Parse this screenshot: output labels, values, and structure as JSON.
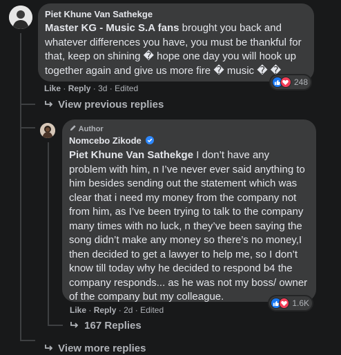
{
  "comment1": {
    "author": "Piet Khune Van Sathekge",
    "tag": "Master KG - Music S.A fans",
    "text": " brought you back and whatever differences you have, you must be thankful for that, keep on shining � hope one day you will hook up together again and give us more fire � music � �",
    "like_label": "Like",
    "reply_label": "Reply",
    "time": "3d",
    "edited_label": "Edited",
    "reaction_count": "248"
  },
  "view_previous_label": "View previous replies",
  "reply1": {
    "badge": "Author",
    "author": "Nomcebo Zikode",
    "tag": "Piet Khune Van Sathekge",
    "text": " I don’t have any problem with him, n I’ve never ever said anything to him besides sending out the statement which was clear that i need my money from the company not from him, as I’ve been trying to talk to the company many times with no luck, n they’ve been saying the song didn’t make any money so there’s no money,I then decided to get a lawyer to help me, so I don’t know till today why he decided to respond b4 the company responds... as he was not my boss/ owner of the company but my colleague.",
    "like_label": "Like",
    "reply_label": "Reply",
    "time": "2d",
    "edited_label": "Edited",
    "reaction_count": "1.6K",
    "replies_label": "167 Replies"
  },
  "view_more_label": "View more replies",
  "colors": {
    "background": "#18191a",
    "bubble": "#3a3b3c",
    "text": "#e4e6eb",
    "secondary": "#b0b3b8",
    "like_blue": "#1877f2",
    "love_red": "#f33e58"
  },
  "icons": [
    "avatar-photo",
    "reply-arrow-icon",
    "pencil-icon",
    "verified-badge-icon",
    "like-reaction-icon",
    "love-reaction-icon"
  ]
}
